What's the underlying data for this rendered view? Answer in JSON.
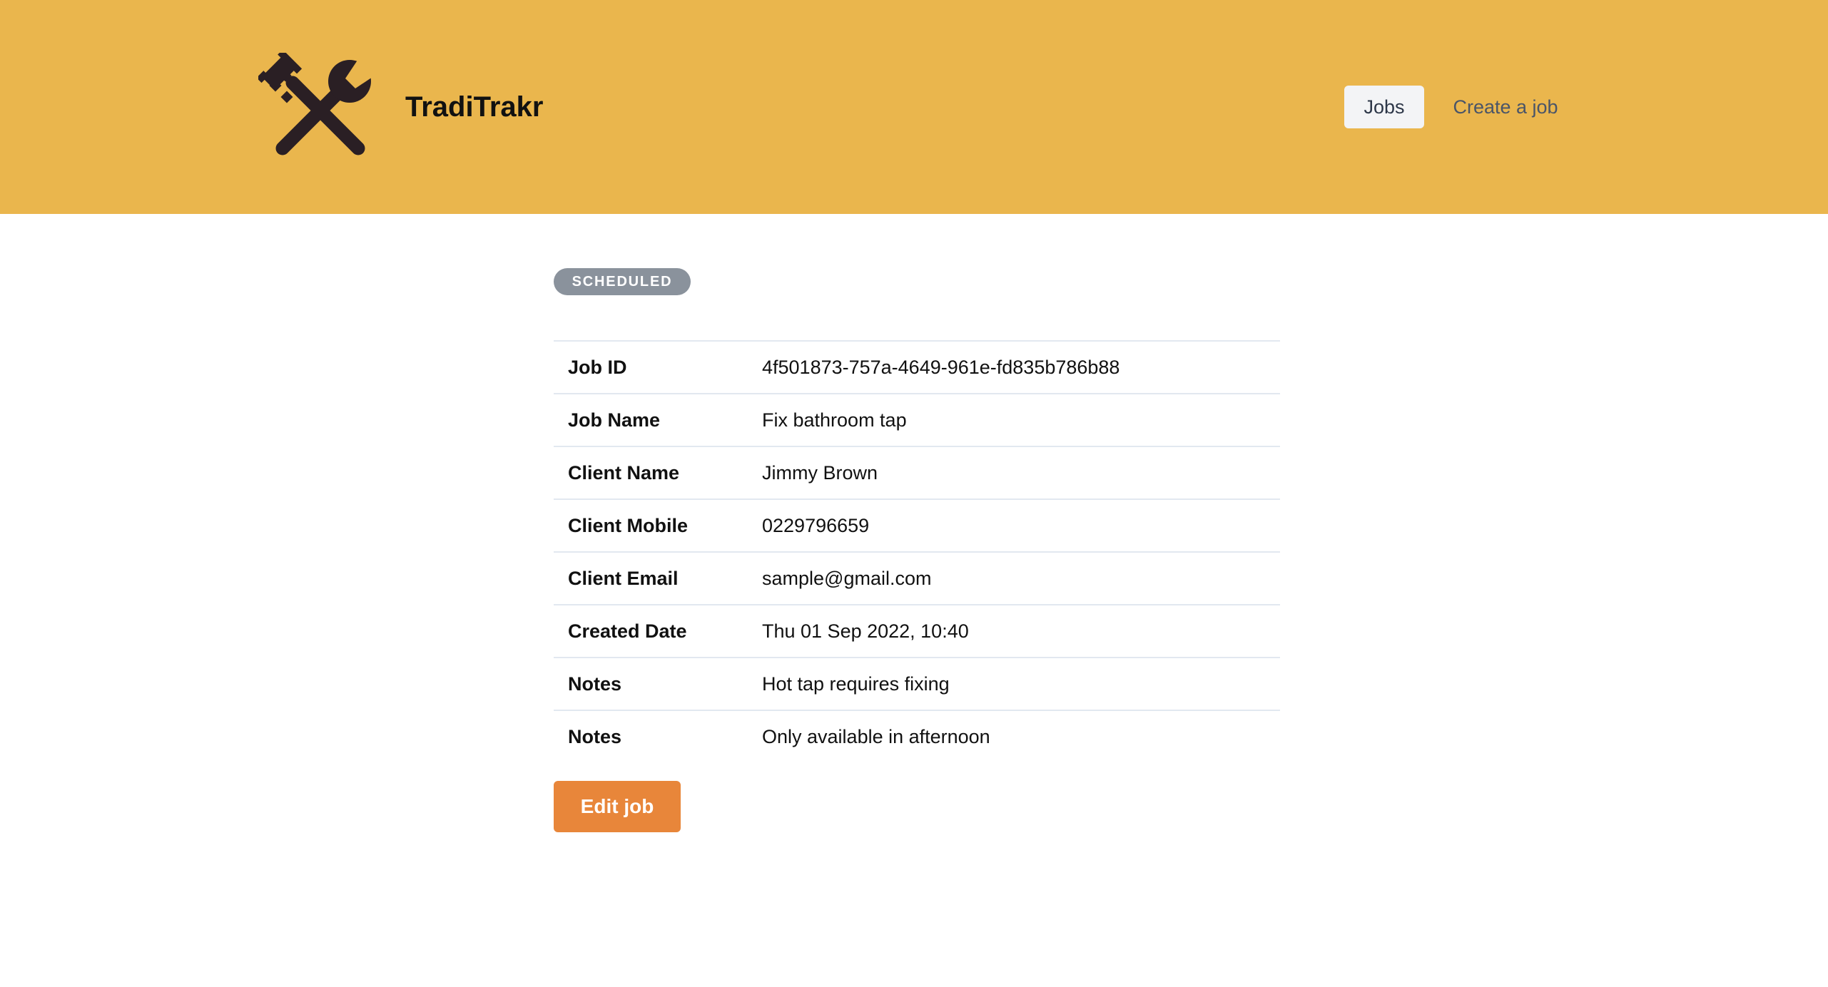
{
  "header": {
    "brand": "TradiTrakr",
    "logo_icon": "wrench-and-pipe-wrench-icon",
    "background_color": "#EAB64D"
  },
  "nav": {
    "items": [
      {
        "label": "Jobs",
        "active": true
      },
      {
        "label": "Create a job",
        "active": false
      }
    ]
  },
  "job": {
    "status": "SCHEDULED",
    "status_color": "#8A929C",
    "fields": [
      {
        "label": "Job ID",
        "value": "4f501873-757a-4649-961e-fd835b786b88"
      },
      {
        "label": "Job Name",
        "value": "Fix bathroom tap"
      },
      {
        "label": "Client Name",
        "value": "Jimmy Brown"
      },
      {
        "label": "Client Mobile",
        "value": "0229796659"
      },
      {
        "label": "Client Email",
        "value": "sample@gmail.com"
      },
      {
        "label": "Created Date",
        "value": "Thu 01 Sep 2022, 10:40"
      },
      {
        "label": "Notes",
        "value": "Hot tap requires fixing"
      },
      {
        "label": "Notes",
        "value": "Only available in afternoon"
      }
    ]
  },
  "actions": {
    "edit_label": "Edit job",
    "edit_color": "#E8863A"
  }
}
